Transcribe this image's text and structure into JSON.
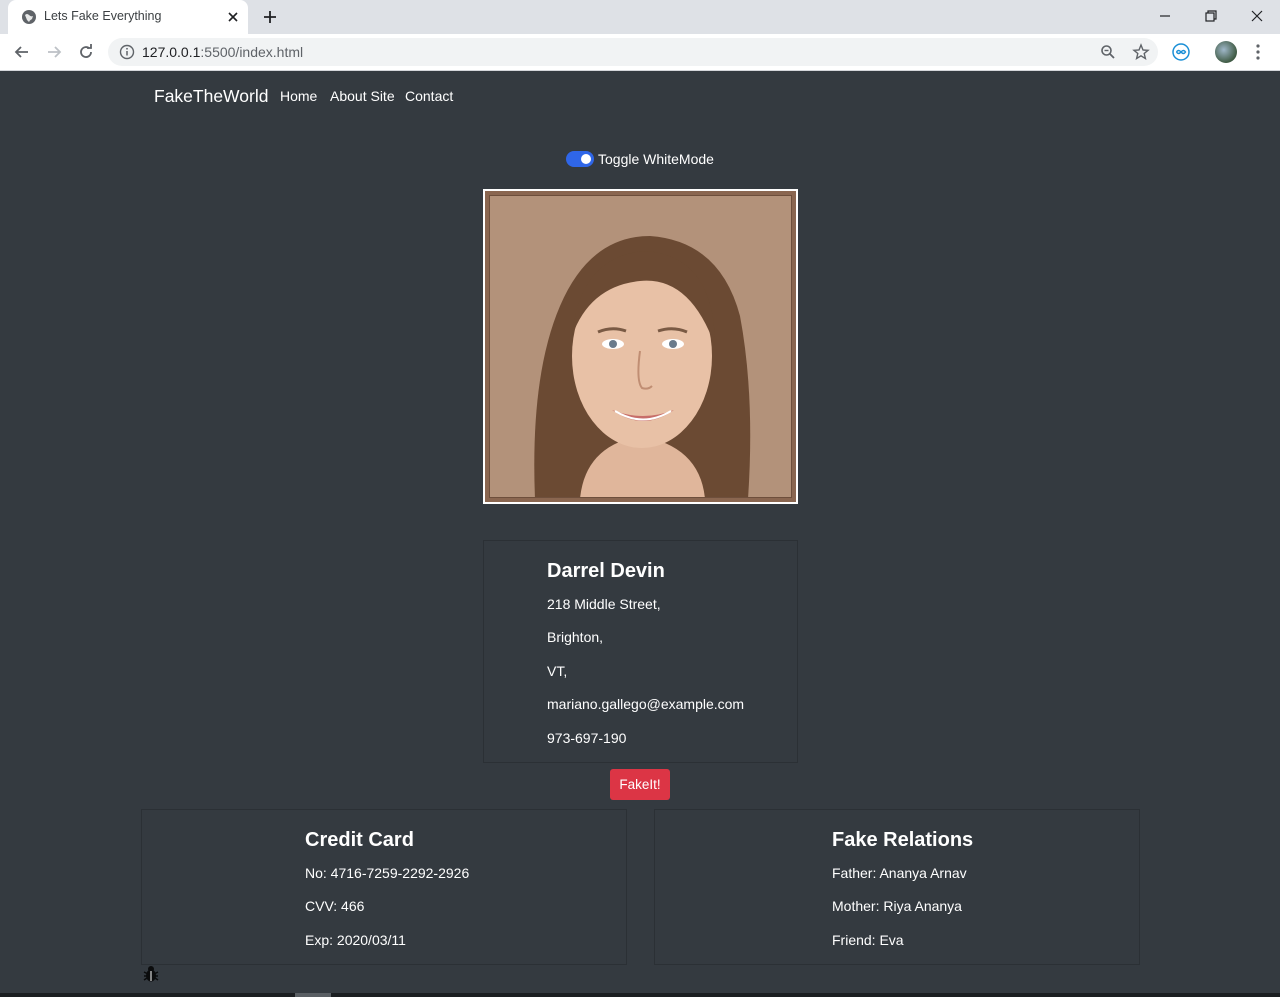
{
  "browser": {
    "tab_title": "Lets Fake Everything",
    "url_host": "127.0.0.1",
    "url_rest": ":5500/index.html"
  },
  "navbar": {
    "brand": "FakeTheWorld",
    "links": [
      "Home",
      "About Site",
      "Contact"
    ]
  },
  "toggle": {
    "label": "Toggle WhiteMode",
    "checked": true,
    "accent": "#2f66e8"
  },
  "profile": {
    "name": "Darrel Devin",
    "street": "218 Middle Street,",
    "city": "Brighton,",
    "state": "VT,",
    "email": "mariano.gallego@example.com",
    "phone": "973-697-190"
  },
  "action": {
    "button_label": "FakeIt!",
    "button_color": "#dc3545"
  },
  "credit_card": {
    "title": "Credit Card",
    "number": "No: 4716-7259-2292-2926",
    "cvv": "CVV: 466",
    "exp": "Exp: 2020/03/11"
  },
  "relations": {
    "title": "Fake Relations",
    "father": "Father: Ananya Arnav",
    "mother": "Mother: Riya Ananya",
    "friend": "Friend: Eva"
  },
  "colors": {
    "page_background": "#343a40"
  }
}
